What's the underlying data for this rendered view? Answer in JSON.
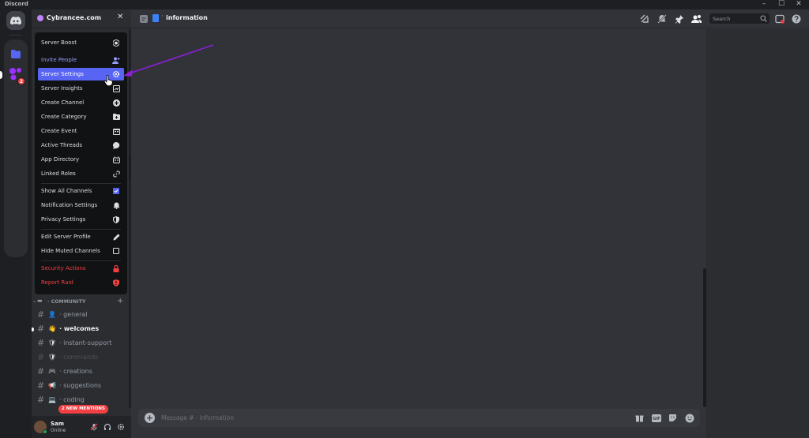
{
  "window": {
    "app_name": "Discord",
    "controls": [
      "–",
      "☐",
      "✕"
    ]
  },
  "rail": {
    "home_icon": "discord-logo-icon",
    "folder_icon": "folder-icon",
    "server_badge": "2"
  },
  "server": {
    "name": "Cybrancee.com",
    "close_icon": "close-icon"
  },
  "menu": {
    "items": [
      {
        "label": "Server Boost",
        "icon": "boost-icon"
      },
      {
        "label": "Invite People",
        "icon": "add-person-icon"
      },
      {
        "label": "Server Settings",
        "icon": "gear-icon"
      },
      {
        "label": "Server Insights",
        "icon": "insights-icon"
      },
      {
        "label": "Create Channel",
        "icon": "plus-circle-icon"
      },
      {
        "label": "Create Category",
        "icon": "folder-plus-icon"
      },
      {
        "label": "Create Event",
        "icon": "calendar-plus-icon"
      },
      {
        "label": "Active Threads",
        "icon": "threads-icon"
      },
      {
        "label": "App Directory",
        "icon": "robot-icon"
      },
      {
        "label": "Linked Roles",
        "icon": "link-icon"
      },
      {
        "label": "Show All Channels",
        "icon": "checkbox-checked-icon"
      },
      {
        "label": "Notification Settings",
        "icon": "bell-icon"
      },
      {
        "label": "Privacy Settings",
        "icon": "shield-icon"
      },
      {
        "label": "Edit Server Profile",
        "icon": "pencil-icon"
      },
      {
        "label": "Hide Muted Channels",
        "icon": "checkbox-empty-icon"
      },
      {
        "label": "Security Actions",
        "icon": "lock-icon"
      },
      {
        "label": "Report Raid",
        "icon": "shield-alert-icon"
      }
    ]
  },
  "category": {
    "name": "COMMUNITY"
  },
  "channels": [
    {
      "name": "general",
      "emoji": "👤"
    },
    {
      "name": "welcomes",
      "emoji": "👋"
    },
    {
      "name": "instant-support",
      "emoji": "🛡"
    },
    {
      "name": "commands",
      "emoji": "🛡"
    },
    {
      "name": "creations",
      "emoji": "🎮"
    },
    {
      "name": "suggestions",
      "emoji": "📢"
    },
    {
      "name": "coding",
      "emoji": "💻"
    }
  ],
  "mentions_badge": "2 NEW MENTIONS",
  "user": {
    "name": "Sam",
    "status": "Online"
  },
  "topbar": {
    "channel_name": "information",
    "search_placeholder": "Search"
  },
  "composer": {
    "placeholder": "Message #  · information"
  },
  "colors": {
    "accent": "#5865f2",
    "danger": "#f23f43",
    "annotation_arrow": "#8b1fd6"
  }
}
